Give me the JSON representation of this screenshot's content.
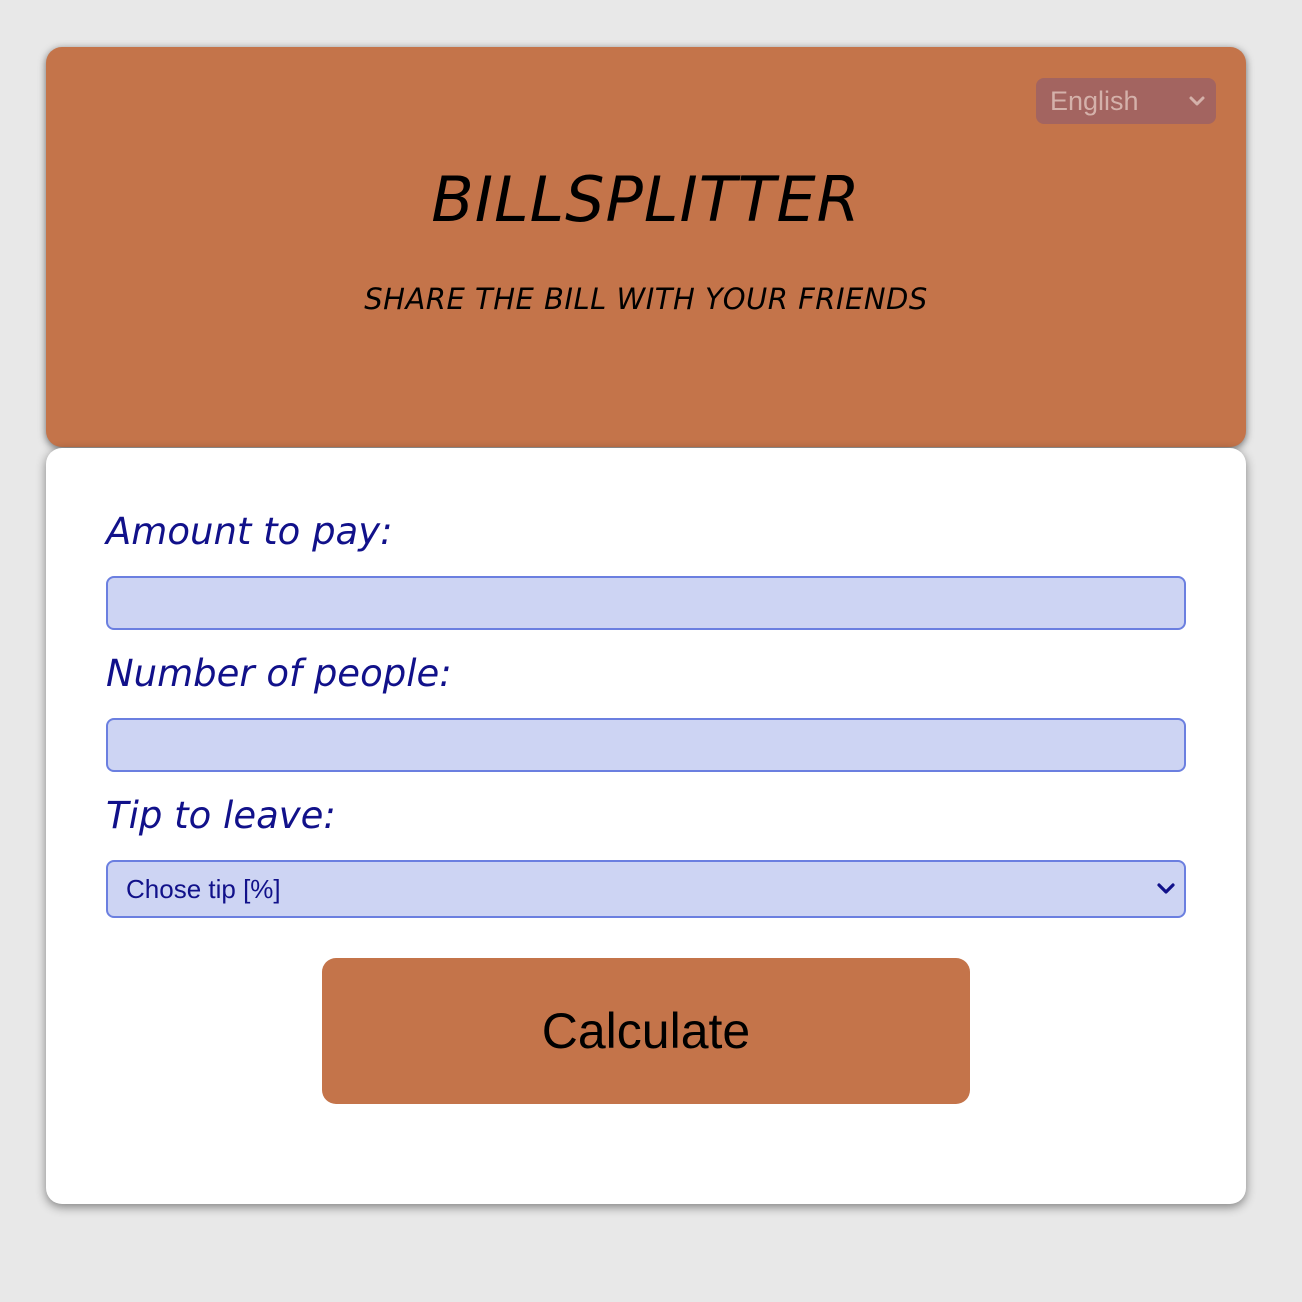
{
  "header": {
    "language": "English",
    "title": "BILLSPLITTER",
    "subtitle": "SHARE THE BILL WITH YOUR FRIENDS"
  },
  "form": {
    "amount_label": "Amount to pay:",
    "amount_value": "",
    "people_label": "Number of people:",
    "people_value": "",
    "tip_label": "Tip to leave:",
    "tip_selected": "Chose tip [%]",
    "calculate_label": "Calculate"
  },
  "colors": {
    "accent": "#c4744a",
    "background": "#e8e8e8",
    "label_text": "#11118a",
    "input_fill": "#cdd4f3",
    "input_border": "#6b7fe0"
  },
  "icons": {
    "language_dropdown": "chevron-down-icon",
    "tip_dropdown": "chevron-down-icon"
  }
}
